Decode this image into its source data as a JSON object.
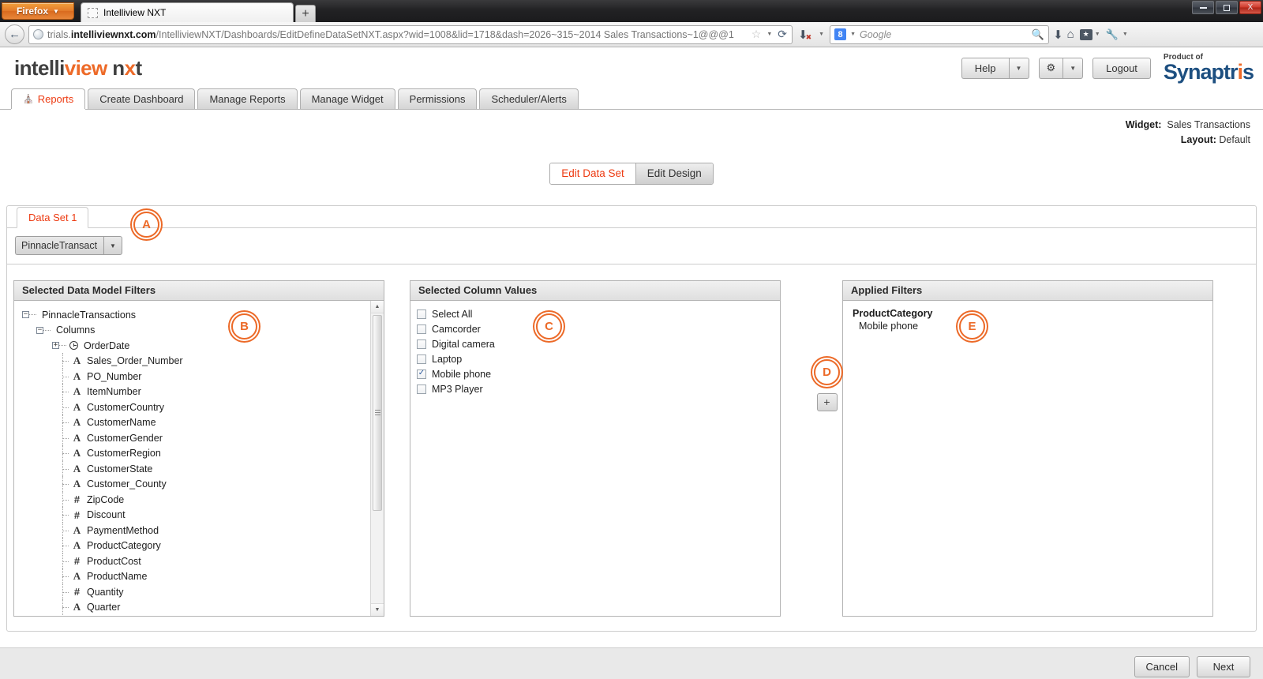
{
  "browser": {
    "firefox_button": "Firefox",
    "tab_title": "Intelliview NXT",
    "new_tab_label": "+",
    "url_prefix": "trials.",
    "url_host": "intelliviewnxt.com",
    "url_path": "/IntelliviewNXT/Dashboards/EditDefineDataSetNXT.aspx?wid=1008&lid=1718&dash=2026~315~2014 Sales Transactions~1@@@1",
    "search_placeholder": "Google",
    "window_controls": {
      "minimize": "minimize-icon",
      "maximize": "maximize-icon",
      "close": "X"
    }
  },
  "app_header": {
    "logo_part1": "intelli",
    "logo_part2": "view",
    "logo_part3a": "n",
    "logo_part3b": "x",
    "logo_part3c": "t",
    "help_label": "Help",
    "settings_icon": "gear-icon",
    "logout_label": "Logout",
    "product_of": "Product of",
    "brand_a": "Synaptr",
    "brand_i": "i",
    "brand_b": "s"
  },
  "nav_tabs": [
    {
      "label": "Reports",
      "active": true,
      "icon": "home-icon"
    },
    {
      "label": "Create Dashboard",
      "active": false
    },
    {
      "label": "Manage Reports",
      "active": false
    },
    {
      "label": "Manage Widget",
      "active": false
    },
    {
      "label": "Permissions",
      "active": false
    },
    {
      "label": "Scheduler/Alerts",
      "active": false
    }
  ],
  "widget_info": {
    "widget_key": "Widget:",
    "widget_value": "Sales Transactions",
    "layout_key": "Layout:",
    "layout_value": "Default"
  },
  "mode_toggle": {
    "edit_data_set": "Edit Data Set",
    "edit_design": "Edit Design",
    "active": "Edit Data Set"
  },
  "dataset": {
    "tab_label": "Data Set 1",
    "model_value": "PinnacleTransact",
    "model_caret": "▼"
  },
  "annotations": [
    {
      "id": "A",
      "label": "A"
    },
    {
      "id": "B",
      "label": "B"
    },
    {
      "id": "C",
      "label": "C"
    },
    {
      "id": "D",
      "label": "D"
    },
    {
      "id": "E",
      "label": "E"
    }
  ],
  "panel_left": {
    "title": "Selected Data Model Filters",
    "root": "PinnacleTransactions",
    "child": "Columns",
    "fields": [
      {
        "name": "OrderDate",
        "type": "date",
        "expandable": true
      },
      {
        "name": "Sales_Order_Number",
        "type": "text"
      },
      {
        "name": "PO_Number",
        "type": "text"
      },
      {
        "name": "ItemNumber",
        "type": "text"
      },
      {
        "name": "CustomerCountry",
        "type": "text"
      },
      {
        "name": "CustomerName",
        "type": "text"
      },
      {
        "name": "CustomerGender",
        "type": "text"
      },
      {
        "name": "CustomerRegion",
        "type": "text"
      },
      {
        "name": "CustomerState",
        "type": "text"
      },
      {
        "name": "Customer_County",
        "type": "text"
      },
      {
        "name": "ZipCode",
        "type": "number"
      },
      {
        "name": "Discount",
        "type": "number"
      },
      {
        "name": "PaymentMethod",
        "type": "text"
      },
      {
        "name": "ProductCategory",
        "type": "text"
      },
      {
        "name": "ProductCost",
        "type": "number"
      },
      {
        "name": "ProductName",
        "type": "text"
      },
      {
        "name": "Quantity",
        "type": "number"
      },
      {
        "name": "Quarter",
        "type": "text"
      }
    ],
    "icons": {
      "text": "A",
      "number": "#",
      "date": "clock-icon",
      "expand": "+",
      "collapse": "-"
    }
  },
  "panel_mid": {
    "title": "Selected Column Values",
    "values": [
      {
        "label": "Select All",
        "checked": false
      },
      {
        "label": "Camcorder",
        "checked": false
      },
      {
        "label": "Digital camera",
        "checked": false
      },
      {
        "label": "Laptop",
        "checked": false
      },
      {
        "label": "Mobile phone",
        "checked": true
      },
      {
        "label": "MP3 Player",
        "checked": false
      }
    ]
  },
  "panel_right": {
    "title": "Applied Filters",
    "groups": [
      {
        "name": "ProductCategory",
        "values": [
          "Mobile phone"
        ]
      }
    ]
  },
  "add_filter_button": {
    "label": "+"
  },
  "footer": {
    "cancel": "Cancel",
    "next": "Next"
  },
  "colors": {
    "accent_orange": "#ed6a28",
    "active_tab_text": "#ed3b12",
    "brand_blue": "#1d4f80"
  }
}
